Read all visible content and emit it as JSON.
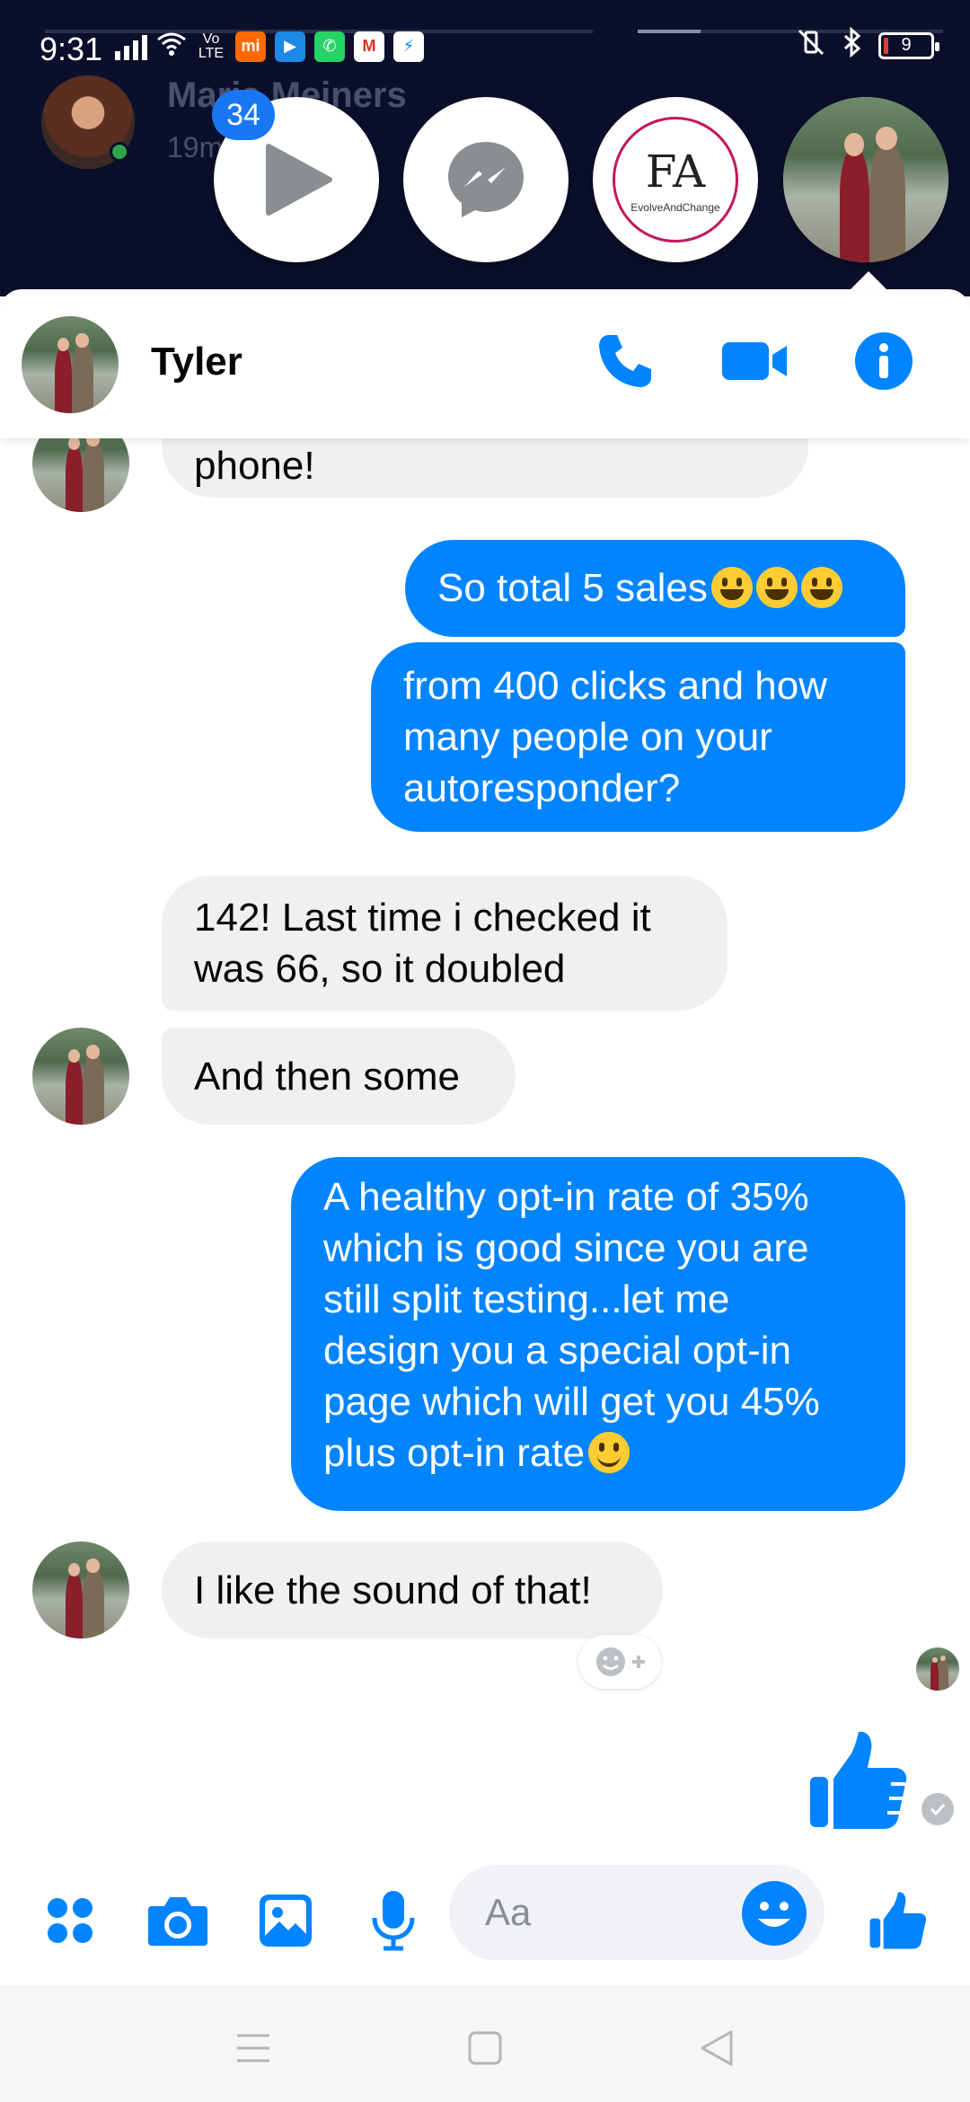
{
  "status_bar": {
    "time": "9:31",
    "volte_label": "VoLTE",
    "battery_level": "9"
  },
  "background_conversation": {
    "name": "Maria Meiners",
    "subtitle": "19m"
  },
  "chat_heads": {
    "badge_count": "34",
    "items": [
      "video-player-head",
      "messenger-head",
      "evolve-and-change-head",
      "tyler-head"
    ],
    "evolve_logo_mark": "FA",
    "evolve_logo_text": "EvolveAndChange"
  },
  "header": {
    "contact_name": "Tyler",
    "call_icon": "phone-icon",
    "video_icon": "video-camera-icon",
    "info_icon": "info-icon",
    "accent_color": "#0084ff"
  },
  "messages": [
    {
      "sender": "Tyler",
      "direction": "incoming",
      "text": "phone!"
    },
    {
      "sender": "me",
      "direction": "outgoing",
      "text": "So total 5 sales",
      "emoji": "😀😀😀"
    },
    {
      "sender": "me",
      "direction": "outgoing",
      "lines": [
        "from 400 clicks and how",
        "many people on your",
        "autoresponder?"
      ]
    },
    {
      "sender": "Tyler",
      "direction": "incoming",
      "lines": [
        "142! Last time i checked it",
        "was 66, so it doubled"
      ]
    },
    {
      "sender": "Tyler",
      "direction": "incoming",
      "text": "And then some"
    },
    {
      "sender": "me",
      "direction": "outgoing",
      "lines": [
        "A healthy opt-in rate of 35%",
        "which is good since you are",
        "still split testing...let me",
        "design you a special opt-in",
        "page which will get you 45%",
        "plus opt-in rate"
      ],
      "emoji": "🙂"
    },
    {
      "sender": "Tyler",
      "direction": "incoming",
      "text": "I like the sound of that!"
    }
  ],
  "composer": {
    "placeholder": "Aa",
    "value": "",
    "icons": [
      "menu-dots-icon",
      "camera-icon",
      "gallery-icon",
      "microphone-icon",
      "emoji-icon",
      "thumbs-up-icon"
    ]
  },
  "colors": {
    "outgoing_bubble": "#0084ff",
    "incoming_bubble": "#f0f0f0",
    "top_overlay": "#0b0f2b"
  }
}
